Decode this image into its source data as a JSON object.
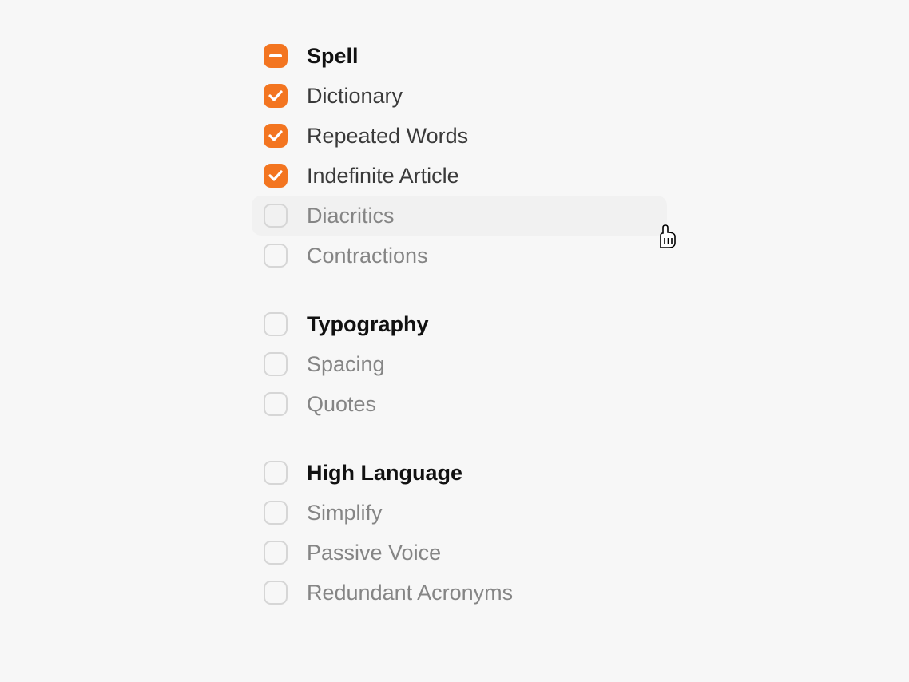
{
  "accent": "#f37520",
  "groups": [
    {
      "id": "spell",
      "header": {
        "label": "Spell",
        "state": "indeterminate"
      },
      "items": [
        {
          "id": "dictionary",
          "label": "Dictionary",
          "state": "checked",
          "hovered": false
        },
        {
          "id": "repeated-words",
          "label": "Repeated Words",
          "state": "checked",
          "hovered": false
        },
        {
          "id": "indefinite-article",
          "label": "Indefinite Article",
          "state": "checked",
          "hovered": false
        },
        {
          "id": "diacritics",
          "label": "Diacritics",
          "state": "unchecked",
          "hovered": true
        },
        {
          "id": "contractions",
          "label": "Contractions",
          "state": "unchecked",
          "hovered": false
        }
      ]
    },
    {
      "id": "typography",
      "header": {
        "label": "Typography",
        "state": "unchecked"
      },
      "items": [
        {
          "id": "spacing",
          "label": "Spacing",
          "state": "unchecked",
          "hovered": false
        },
        {
          "id": "quotes",
          "label": "Quotes",
          "state": "unchecked",
          "hovered": false
        }
      ]
    },
    {
      "id": "high-language",
      "header": {
        "label": "High Language",
        "state": "unchecked"
      },
      "items": [
        {
          "id": "simplify",
          "label": "Simplify",
          "state": "unchecked",
          "hovered": false
        },
        {
          "id": "passive-voice",
          "label": "Passive Voice",
          "state": "unchecked",
          "hovered": false
        },
        {
          "id": "redundant-acronyms",
          "label": "Redundant Acronyms",
          "state": "unchecked",
          "hovered": false
        }
      ]
    }
  ]
}
